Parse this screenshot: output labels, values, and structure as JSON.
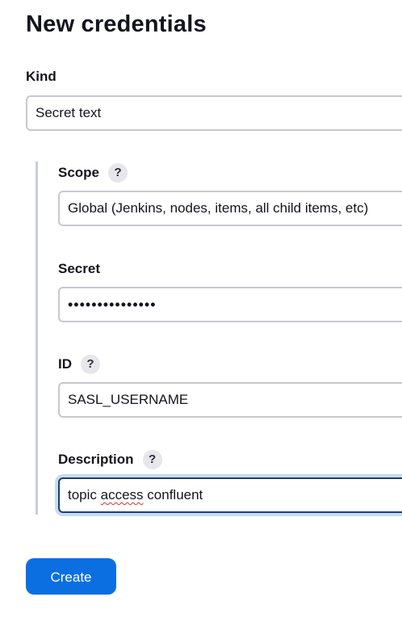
{
  "page": {
    "title": "New credentials"
  },
  "kind": {
    "label": "Kind",
    "value": "Secret text"
  },
  "scope": {
    "label": "Scope",
    "help": "?",
    "value": "Global (Jenkins, nodes, items, all child items, etc)"
  },
  "secret": {
    "label": "Secret",
    "masked_value": "•••••••••••••••"
  },
  "id": {
    "label": "ID",
    "help": "?",
    "value": "SASL_USERNAME"
  },
  "description": {
    "label": "Description",
    "help": "?",
    "value_before": "topic ",
    "value_misspelled": "access",
    "value_after": " confluent"
  },
  "actions": {
    "create_label": "Create"
  },
  "colors": {
    "primary_button": "#0b6fe2",
    "focus_ring": "#c6dbf2",
    "focus_border": "#1b3f73",
    "input_border": "#c8c8d0",
    "help_bg": "#e6e6eb"
  }
}
